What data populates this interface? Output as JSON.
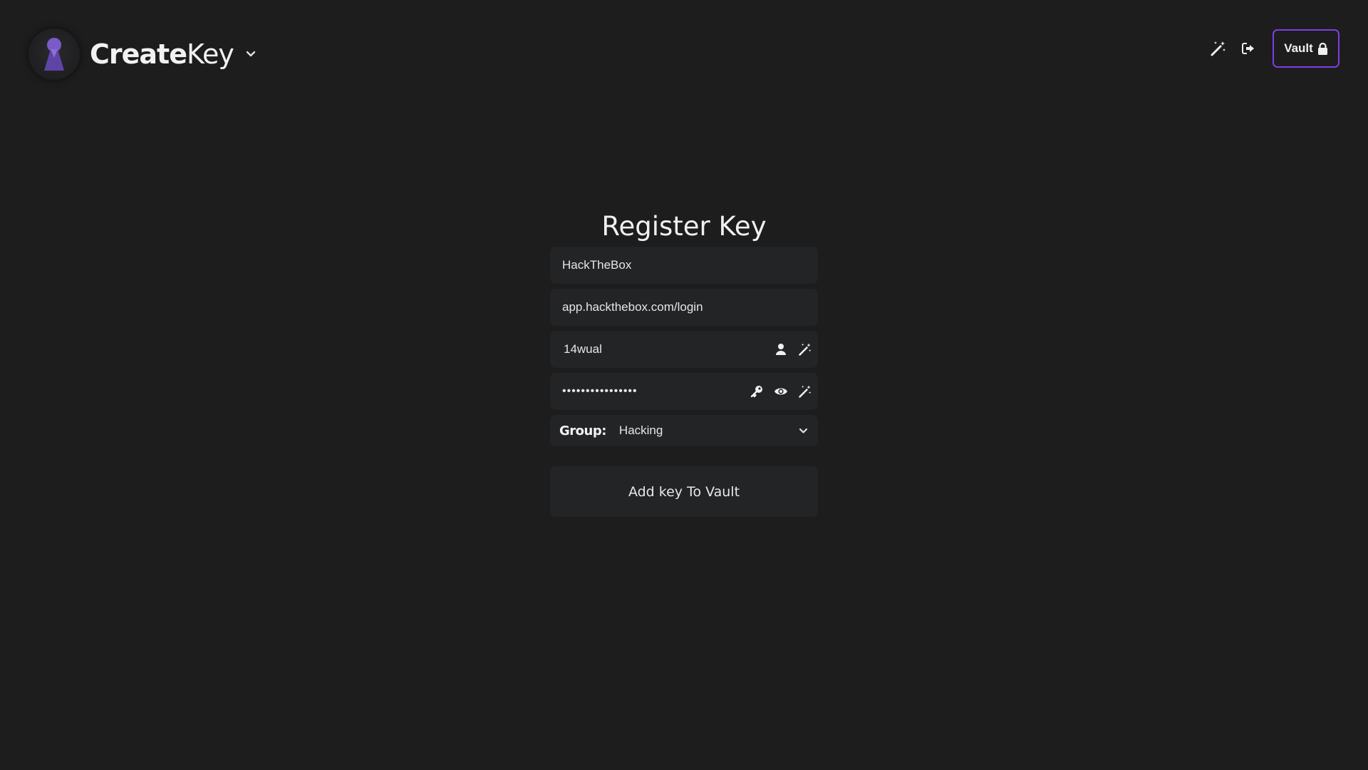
{
  "header": {
    "brand_strong": "Create",
    "brand_light": "Key",
    "vault_label": "Vault",
    "icons": {
      "logo": "keyhole-logo",
      "brand_menu": "chevron-down-icon",
      "generate": "magic-wand-icon",
      "logout": "sign-out-icon",
      "vault_lock": "lock-icon"
    }
  },
  "form": {
    "title": "Register Key",
    "name_value": "HackTheBox",
    "url_value": "app.hackthebox.com/login",
    "username_value": "14wual",
    "password_value": "••••••••••••••••",
    "username_icons": [
      "user-icon",
      "magic-wand-icon"
    ],
    "password_icons": [
      "key-icon",
      "eye-icon",
      "magic-wand-icon"
    ],
    "group_label": "Group:",
    "group_value": "Hacking",
    "submit_label": "Add key To Vault"
  },
  "colors": {
    "background": "#1d1d1d",
    "field_background": "#232425",
    "accent": "#7b3fe4",
    "logo_purple": "#7a5bc9"
  }
}
